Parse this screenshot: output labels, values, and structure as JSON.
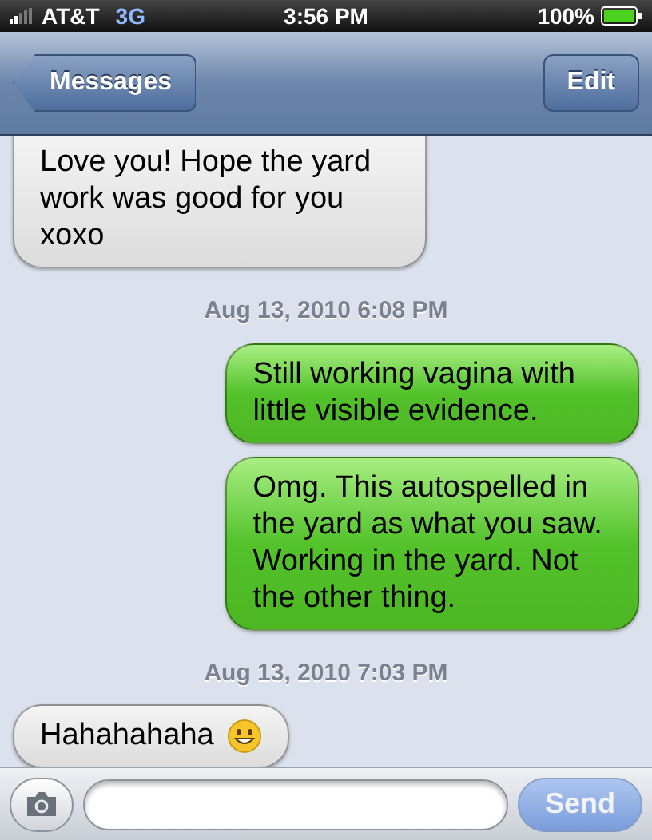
{
  "status_bar": {
    "carrier": "AT&T",
    "network": "3G",
    "time": "3:56 PM",
    "battery": "100%"
  },
  "nav_bar": {
    "back_button": "Messages",
    "edit_button": "Edit"
  },
  "conversation": [
    {
      "kind": "received",
      "text": "Love you! Hope the yard work was good for you xoxo",
      "emoji": false,
      "cut_top": true
    },
    {
      "kind": "timestamp",
      "text": "Aug 13, 2010 6:08 PM"
    },
    {
      "kind": "sent",
      "text": "Still working vagina with little visible evidence.",
      "emoji": false,
      "cut_top": false
    },
    {
      "kind": "sent",
      "text": "Omg. This autospelled in the yard as what you saw. Working in the yard. Not the other thing.",
      "emoji": false,
      "cut_top": false
    },
    {
      "kind": "timestamp",
      "text": "Aug 13, 2010 7:03 PM"
    },
    {
      "kind": "received",
      "text": "Hahahahaha",
      "emoji": true,
      "cut_top": false
    }
  ],
  "compose": {
    "send_button": "Send",
    "send_disabled": true
  }
}
